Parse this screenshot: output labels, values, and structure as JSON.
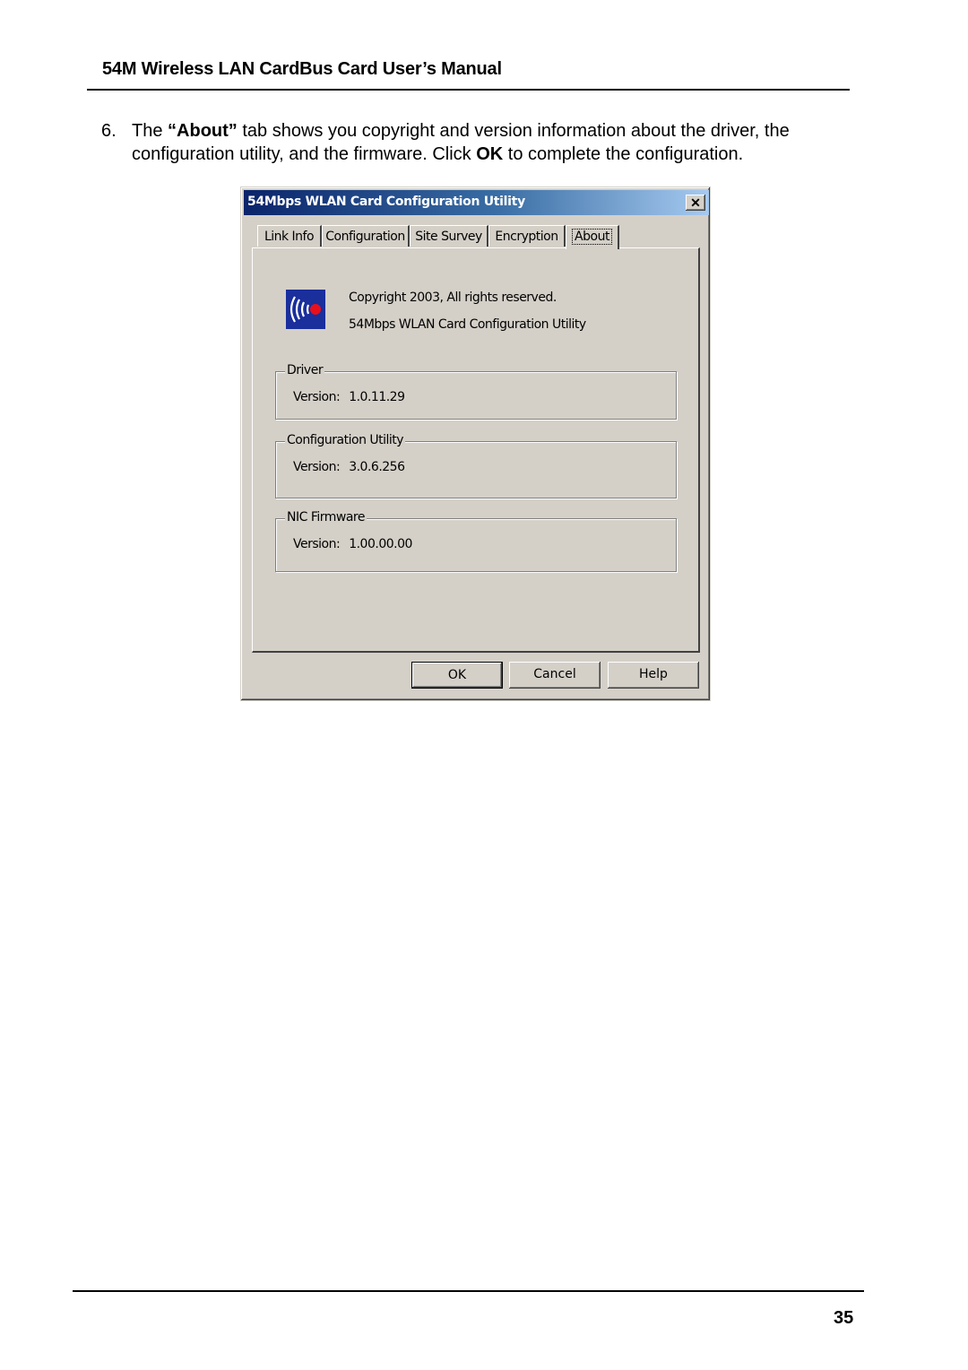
{
  "document": {
    "header_title": "54M Wireless LAN CardBus Card User’s Manual",
    "step_number": "6.",
    "step_parts": {
      "p1": "The ",
      "b1": "“About”",
      "p2": " tab shows you copyright and version information about the driver, the configuration utility, and the firmware. Click ",
      "b2": "OK",
      "p3": " to complete the configuration."
    },
    "page_number": "35"
  },
  "dialog": {
    "title": "54Mbps WLAN Card Configuration Utility",
    "close_label": "✕",
    "tabs": [
      {
        "label": "Link Info"
      },
      {
        "label": "Configuration"
      },
      {
        "label": "Site Survey"
      },
      {
        "label": "Encryption"
      },
      {
        "label": "About",
        "active": true
      }
    ],
    "about": {
      "copyright": "Copyright 2003, All rights reserved.",
      "product": "54Mbps WLAN Card Configuration Utility"
    },
    "groups": [
      {
        "legend": "Driver",
        "label": "Version:",
        "value": "1.0.11.29"
      },
      {
        "legend": "Configuration Utility",
        "label": "Version:",
        "value": "3.0.6.256"
      },
      {
        "legend": "NIC Firmware",
        "label": "Version:",
        "value": "1.00.00.00"
      }
    ],
    "buttons": {
      "ok": "OK",
      "cancel": "Cancel",
      "help": "Help"
    }
  },
  "colors": {
    "titlebar_start": "#0a246a",
    "titlebar_end": "#a6caf0",
    "dialog_face": "#d4d0c8",
    "logo_bg": "#1a2e9c",
    "logo_dot": "#e8101c"
  }
}
